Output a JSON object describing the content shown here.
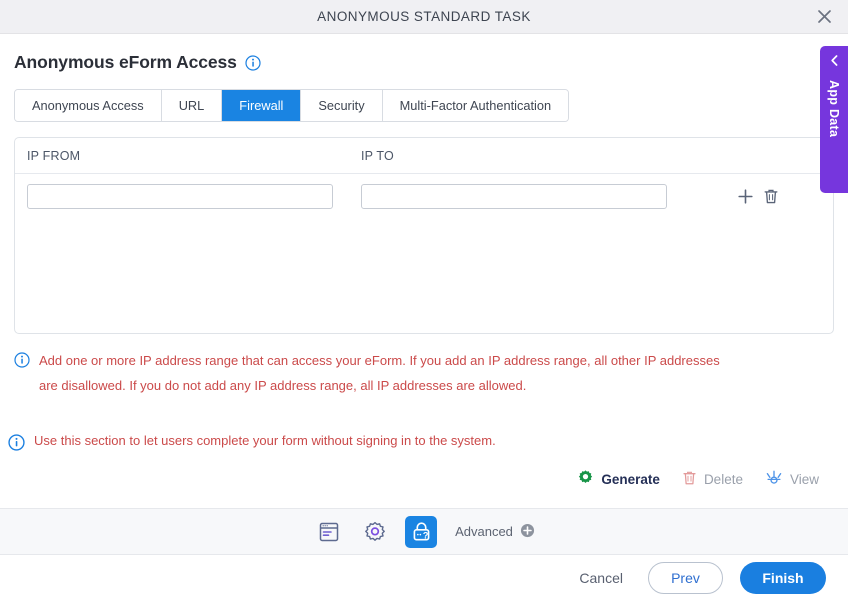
{
  "window": {
    "title": "ANONYMOUS STANDARD TASK",
    "close_icon": "close-icon"
  },
  "page": {
    "heading": "Anonymous eForm Access",
    "heading_info_icon": "info-icon"
  },
  "tabs": [
    {
      "label": "Anonymous Access",
      "active": false
    },
    {
      "label": "URL",
      "active": false
    },
    {
      "label": "Firewall",
      "active": true
    },
    {
      "label": "Security",
      "active": false
    },
    {
      "label": "Multi-Factor Authentication",
      "active": false
    }
  ],
  "firewall_table": {
    "columns": [
      "IP FROM",
      "IP TO"
    ],
    "rows": [
      {
        "ip_from": "",
        "ip_to": "",
        "ip_from_placeholder": "",
        "ip_to_placeholder": ""
      }
    ],
    "row_actions": [
      {
        "name": "add-row-icon",
        "label": "Add"
      },
      {
        "name": "delete-row-icon",
        "label": "Delete"
      }
    ]
  },
  "notes": [
    {
      "icon": "info-icon",
      "text": "Add one or more IP address range that can access your eForm. If you add an IP address range, all other IP addresses are disallowed. If you do not add any IP address range, all IP addresses are allowed."
    },
    {
      "icon": "info-icon",
      "text": "Use this section to let users complete your form without signing in to the system."
    }
  ],
  "actions": [
    {
      "label": "Generate",
      "icon": "gear-icon",
      "enabled": true
    },
    {
      "label": "Delete",
      "icon": "trash-icon",
      "enabled": false
    },
    {
      "label": "View",
      "icon": "view-icon",
      "enabled": false
    }
  ],
  "toolbar": {
    "icons": [
      {
        "name": "form-icon",
        "active": false
      },
      {
        "name": "gear-icon",
        "active": false
      },
      {
        "name": "lock-question-icon",
        "active": true
      }
    ],
    "advanced_label": "Advanced",
    "advanced_icon": "plus-circle-icon"
  },
  "footer": {
    "cancel_label": "Cancel",
    "prev_label": "Prev",
    "finish_label": "Finish"
  },
  "side_panel": {
    "label": "App Data",
    "chevron_icon": "chevron-left-icon"
  },
  "colors": {
    "accent_blue": "#1a7fe0",
    "tab_active": "#1a84e2",
    "note_red": "#cb4a4a",
    "purple": "#7636dd",
    "green": "#1a8a3c",
    "title_bar": "#f0f0f3"
  }
}
